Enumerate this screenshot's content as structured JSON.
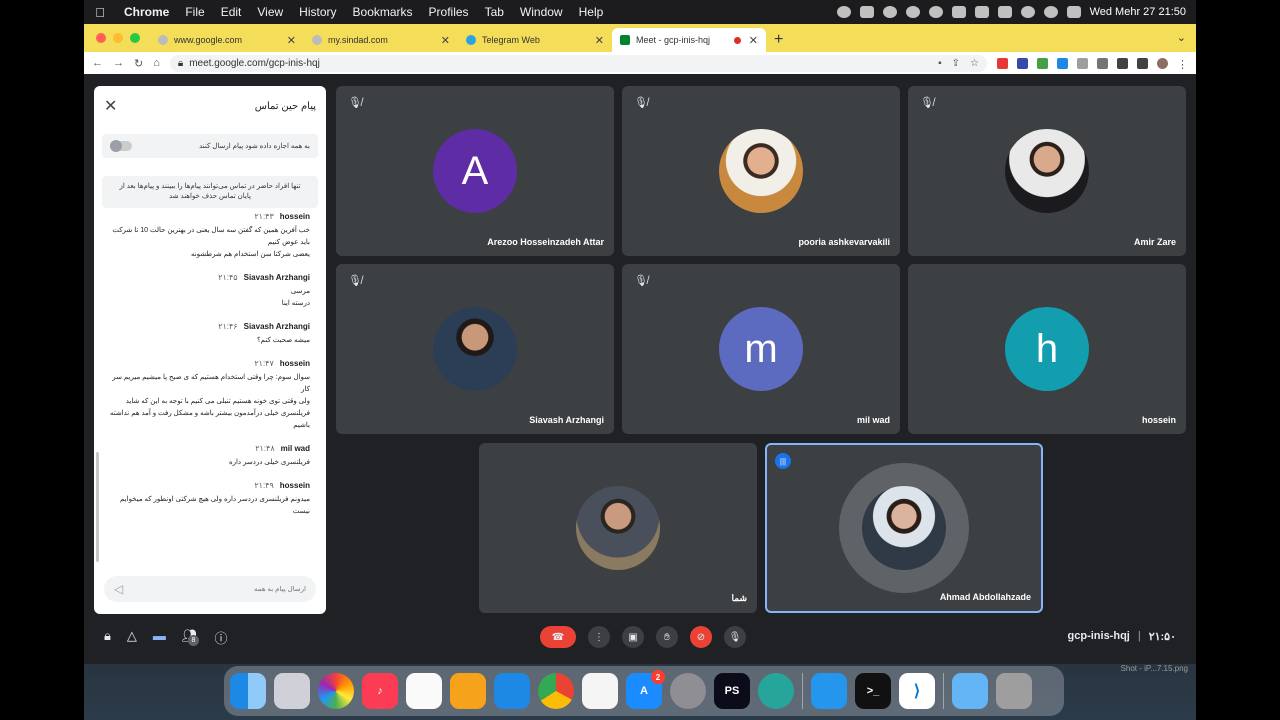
{
  "menubar": {
    "app": "Chrome",
    "items": [
      "File",
      "Edit",
      "View",
      "History",
      "Bookmarks",
      "Profiles",
      "Tab",
      "Window",
      "Help"
    ],
    "datetime": "Wed Mehr 27  21:50"
  },
  "tabs": [
    {
      "title": "www.google.com"
    },
    {
      "title": "my.sindad.com"
    },
    {
      "title": "Telegram Web"
    },
    {
      "title": "Meet - gcp-inis-hqj"
    }
  ],
  "url": "meet.google.com/gcp-inis-hqj",
  "chat": {
    "title": "پیام حین تماس",
    "toggle_label": "به همه اجازه داده شود پیام ارسال کنند",
    "info": "تنها افراد حاضر در تماس می‌توانند پیام‌ها را ببینند و پیام‌ها بعد از پایان تماس حذف خواهند شد",
    "messages": [
      {
        "sender": "hossein",
        "time": "۲۱:۴۳",
        "lines": [
          "خب آفرین همین که گفتن سه سال یعنی در بهترین حالت 10 تا شرکت",
          "باید عوض کنیم",
          "یعضی شرکتا سن استخدام هم شرطشونه"
        ]
      },
      {
        "sender": "Siavash Arzhangi",
        "time": "۲۱:۴۵",
        "lines": [
          "مرسی",
          "درسته اینا"
        ]
      },
      {
        "sender": "Siavash Arzhangi",
        "time": "۲۱:۴۶",
        "lines": [
          "میشه صحبت کنم؟"
        ]
      },
      {
        "sender": "hossein",
        "time": "۲۱:۴۷",
        "lines": [
          "سوال سوم: چرا وقتی استخدام هستیم که ی صبح پا میشیم میریم سر کار",
          "ولی وقتی توی خونه هستیم تنبلی می کنیم با توجه به این که شاید",
          "فریلنسری خیلی درآمدمون بیشتر باشه و مشکل رفت و آمد هم نداشته",
          "باشیم"
        ]
      },
      {
        "sender": "mil wad",
        "time": "۲۱:۴۸",
        "lines": [
          "فریلنسری خیلی دردسر داره"
        ]
      },
      {
        "sender": "hossein",
        "time": "۲۱:۴۹",
        "lines": [
          "میدونم فریلنسری دردسر داره ولی هیچ شرکتی اونطور که میخوایم نیست"
        ]
      }
    ],
    "input_placeholder": "ارسال پیام به همه"
  },
  "participants": [
    {
      "name": "Arezoo Hosseinzadeh Attar",
      "initial": "A",
      "color": "#5e2ca5",
      "muted": true
    },
    {
      "name": "pooria ashkevarvakili",
      "photo": true,
      "muted": true
    },
    {
      "name": "Amir Zare",
      "photo": true,
      "muted": true
    },
    {
      "name": "Siavash Arzhangi",
      "photo": true,
      "muted": true
    },
    {
      "name": "mil wad",
      "initial": "m",
      "color": "#5c6bc0",
      "muted": true
    },
    {
      "name": "hossein",
      "initial": "h",
      "color": "#129eaf",
      "muted": false
    },
    {
      "name": "شما",
      "photo": true,
      "muted": false
    },
    {
      "name": "Ahmad Abdollahzade",
      "photo": true,
      "speaking": true
    }
  ],
  "bottombar": {
    "people_count": "8",
    "meeting_code": "gcp-inis-hqj",
    "time": "۲۱:۵۰"
  },
  "dock_badge": "2",
  "screenshot_label": "Shot - iP...7.15.png"
}
